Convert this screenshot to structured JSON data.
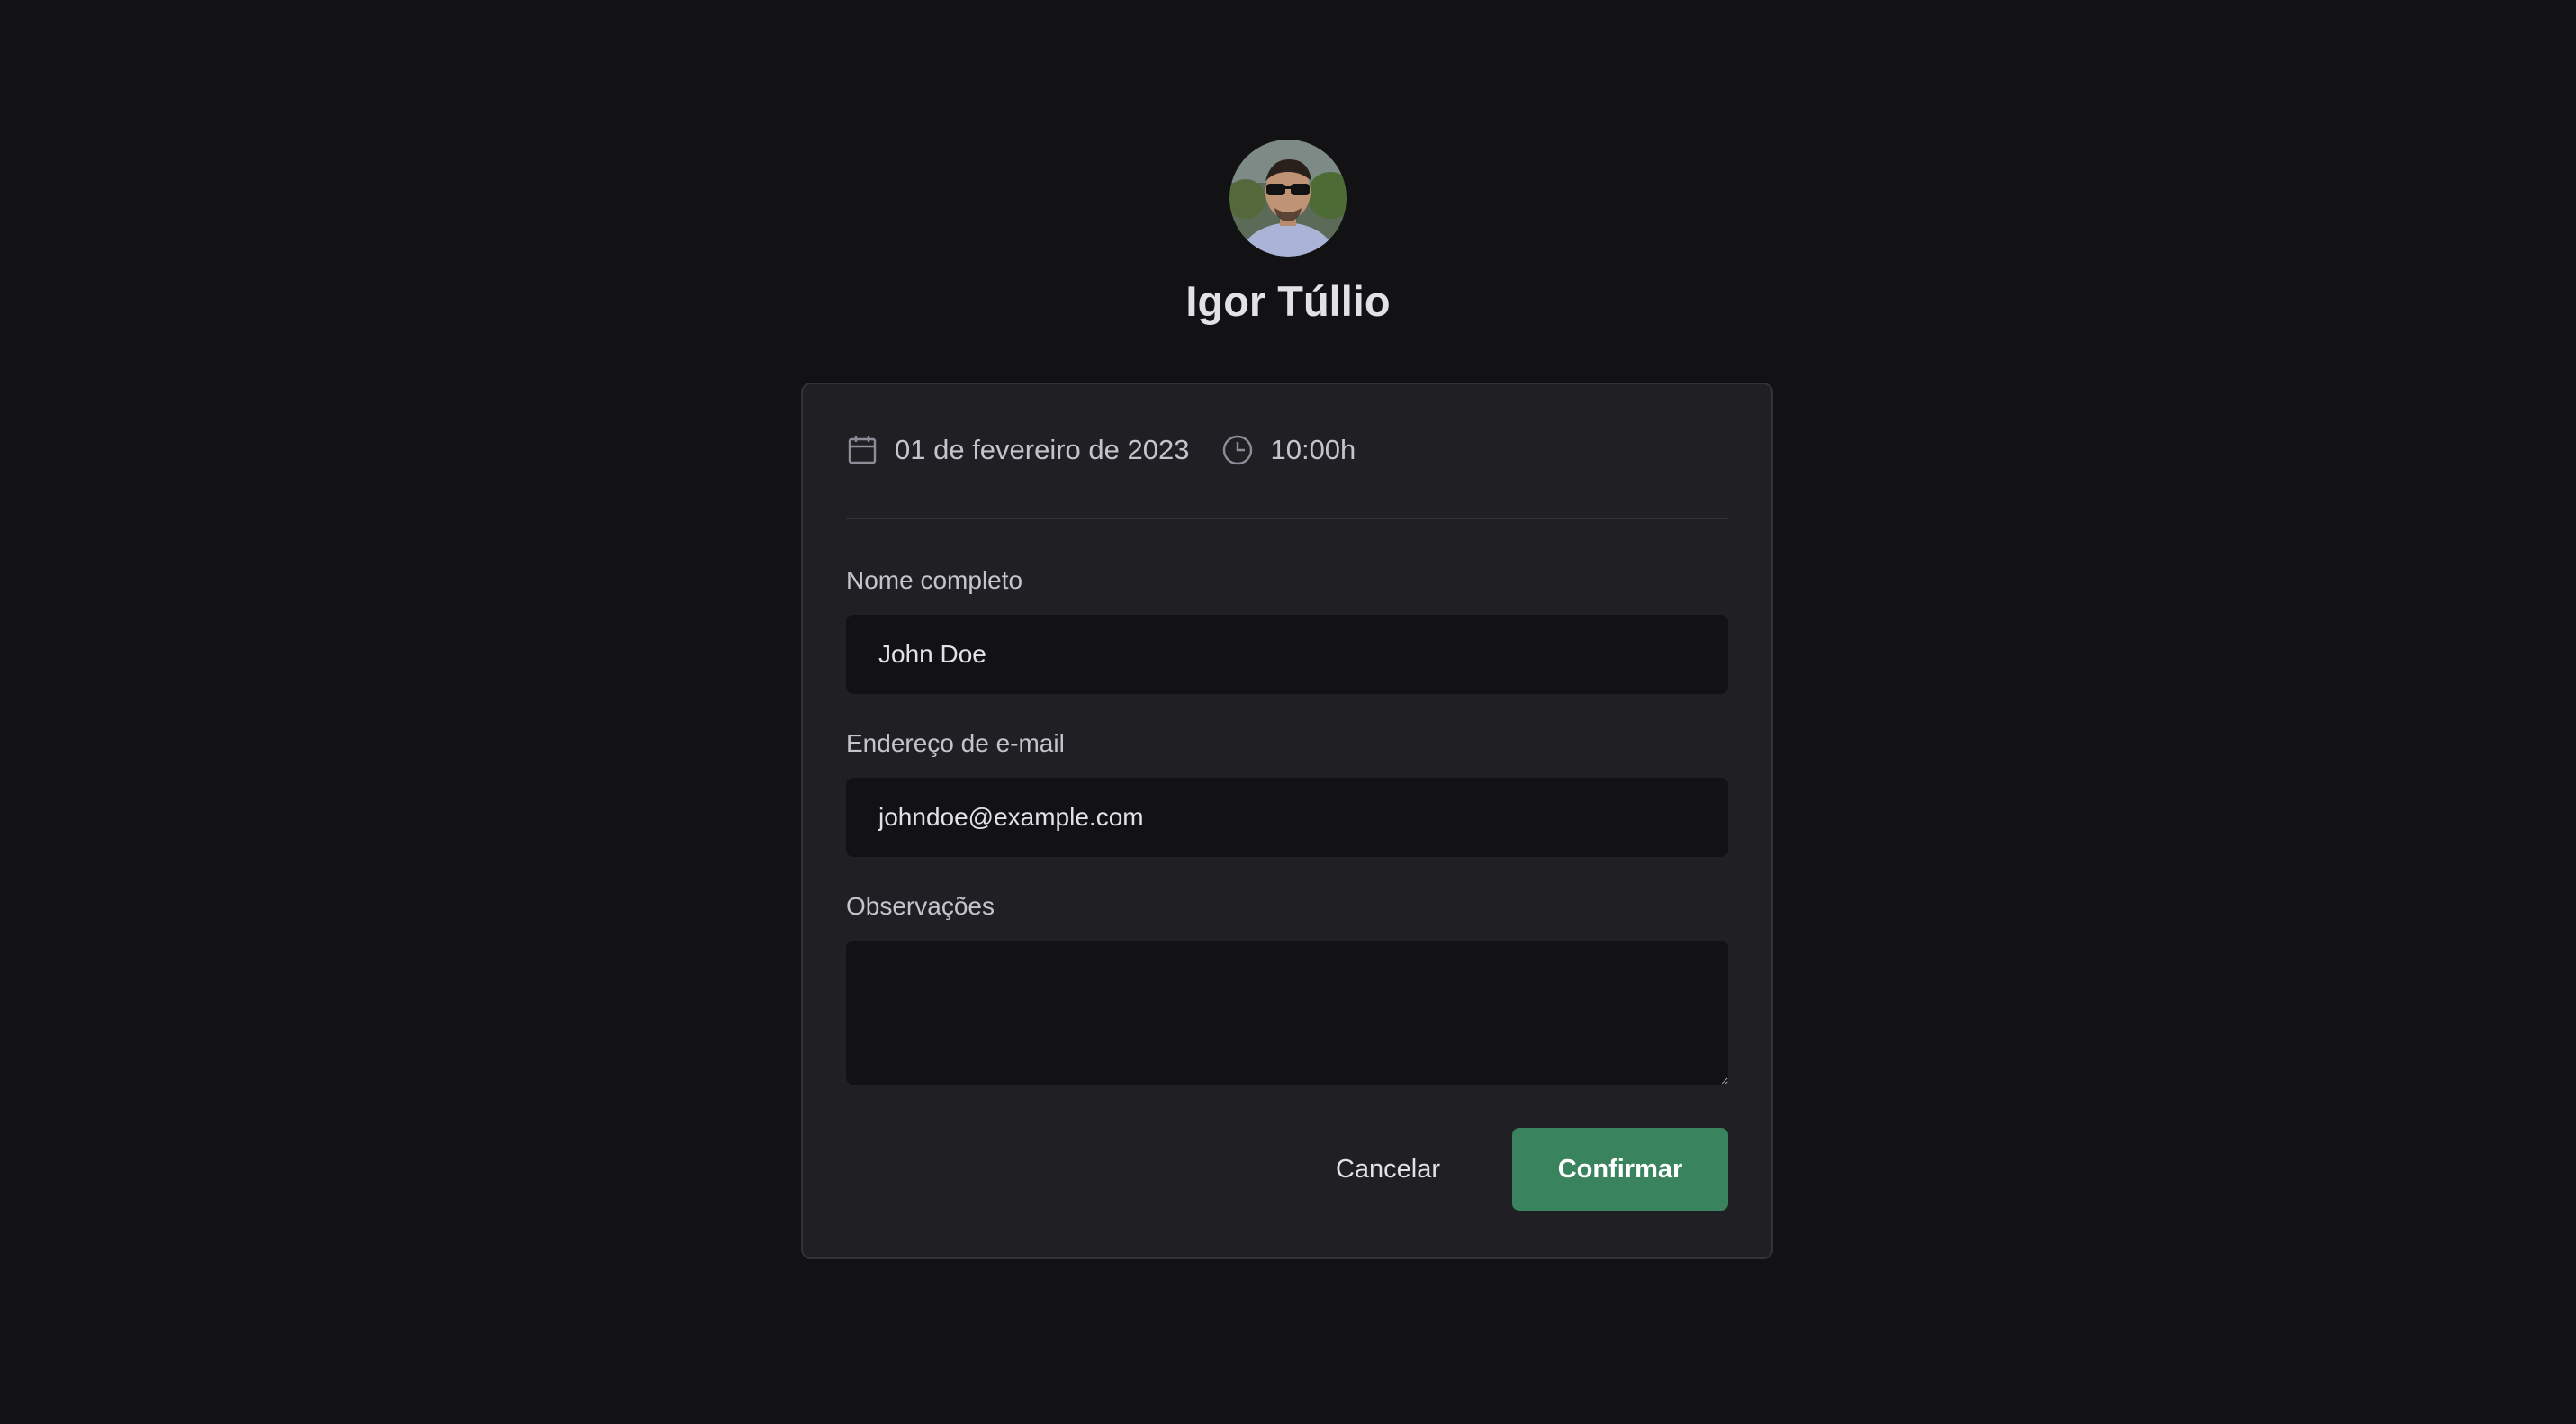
{
  "profile": {
    "name": "Igor Túllio"
  },
  "schedule": {
    "date_icon": "calendar-icon",
    "date": "01 de fevereiro de 2023",
    "time_icon": "clock-icon",
    "time": "10:00h"
  },
  "form": {
    "name_label": "Nome completo",
    "name_value": "John Doe",
    "email_label": "Endereço de e-mail",
    "email_value": "johndoe@example.com",
    "notes_label": "Observações",
    "notes_value": ""
  },
  "actions": {
    "cancel_label": "Cancelar",
    "confirm_label": "Confirmar"
  },
  "colors": {
    "background": "#121214",
    "card": "#202024",
    "border": "#323238",
    "input_background": "#121214",
    "accent": "#39845f",
    "text": "#e1e1e6",
    "muted_text": "#c4c4cc"
  }
}
